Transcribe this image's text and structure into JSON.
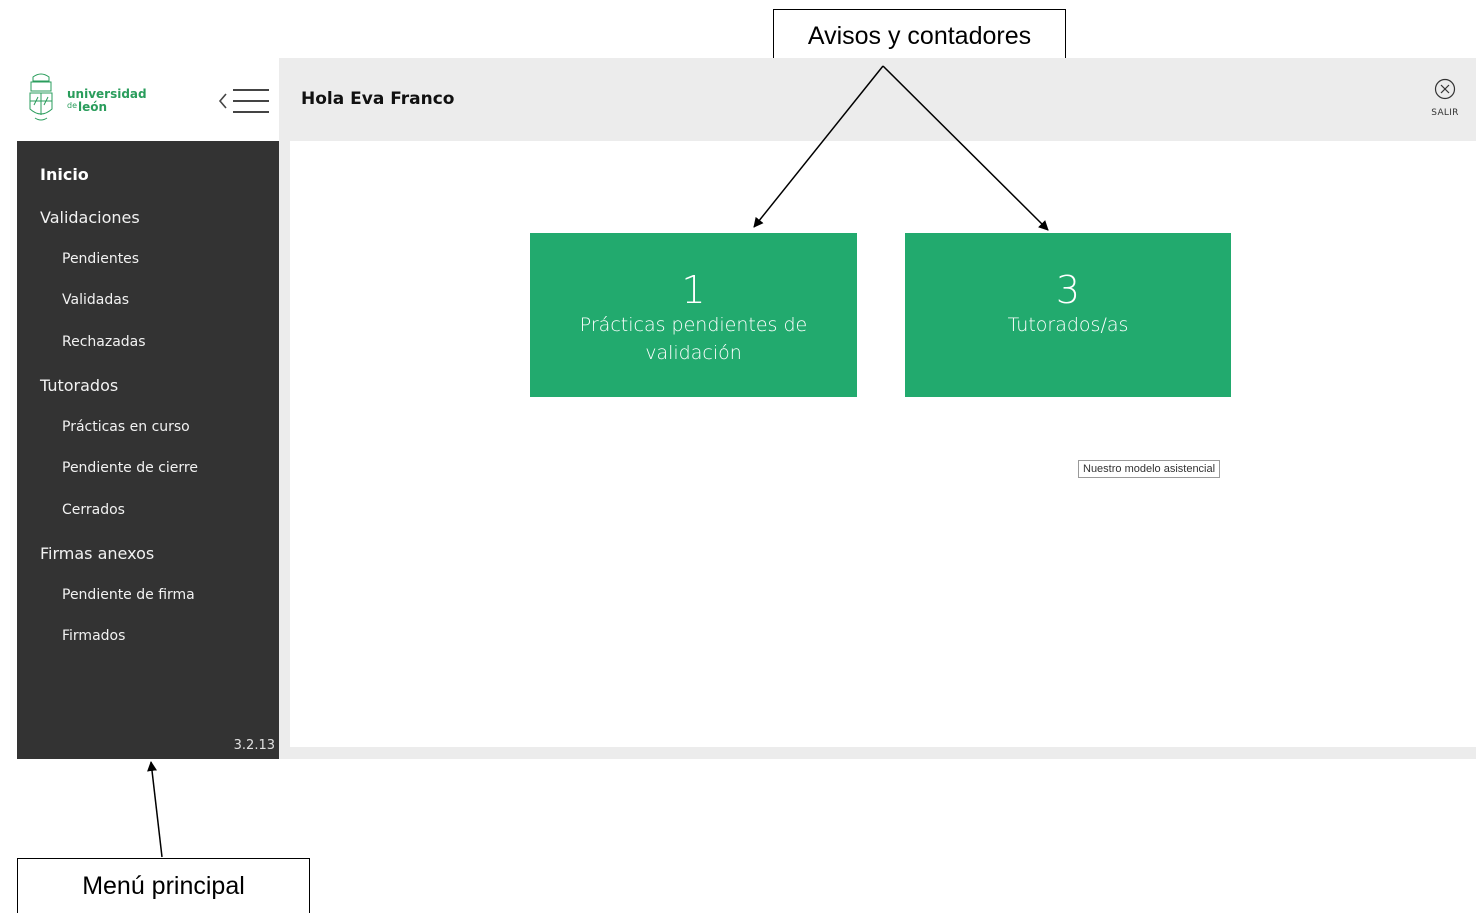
{
  "annotations": {
    "top_callout": "Avisos y contadores",
    "bottom_callout": "Menú principal"
  },
  "brand": {
    "line1": "universidad",
    "line2_prefix": "de",
    "line2": "león",
    "color": "#2a9d5c"
  },
  "header": {
    "greeting": "Hola Eva Franco",
    "logout_label": "SALIR"
  },
  "sidebar": {
    "items": [
      {
        "label": "Inicio",
        "level": "top",
        "active": true
      },
      {
        "label": "Validaciones",
        "level": "top"
      },
      {
        "label": "Pendientes",
        "level": "sub"
      },
      {
        "label": "Validadas",
        "level": "sub"
      },
      {
        "label": "Rechazadas",
        "level": "sub"
      },
      {
        "label": "Tutorados",
        "level": "top"
      },
      {
        "label": "Prácticas en curso",
        "level": "sub"
      },
      {
        "label": "Pendiente de cierre",
        "level": "sub"
      },
      {
        "label": "Cerrados",
        "level": "sub"
      },
      {
        "label": "Firmas anexos",
        "level": "top"
      },
      {
        "label": "Pendiente de firma",
        "level": "sub"
      },
      {
        "label": "Firmados",
        "level": "sub"
      }
    ],
    "version": "3.2.13"
  },
  "cards": [
    {
      "count": "1",
      "label": "Prácticas pendientes de validación"
    },
    {
      "count": "3",
      "label": "Tutorados/as"
    }
  ],
  "tooltip": "Nuestro modelo asistencial",
  "colors": {
    "sidebar_bg": "#333333",
    "card_green": "#22aa6e",
    "header_bg": "#ececec"
  },
  "icons": {
    "menu_toggle": "hamburger-collapse-icon",
    "logout": "close-circle-icon",
    "logo": "university-crest-icon"
  }
}
